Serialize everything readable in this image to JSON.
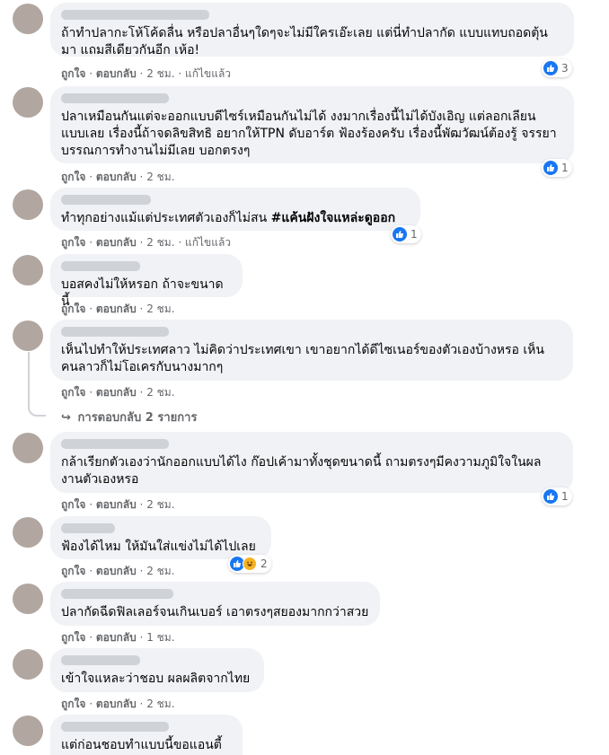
{
  "actions": {
    "like": "ถูกใจ",
    "reply": "ตอบกลับ",
    "edited": "แก้ไขแล้ว",
    "sep": " · "
  },
  "comments": [
    {
      "text": "ถ้าทำปลากะโห้โค้ดลื่น หรือปลาอื่นๆใดๆจะไม่มีใครเอ๊ะเลย แต่นี่ทำปลากัด แบบแทบถอดตุ้น\nมา แถมสีเดียวกันอีก เห้อ!",
      "time": "2 ชม.",
      "edited": true,
      "reactions": "3"
    },
    {
      "text": "ปลาเหมือนกันแต่จะออกแบบดีไซร์เหมือนกันไม่ได้ งงมากเรื่องนี้ไม่ได้บังเอิญ แต่ลอกเลียน\nแบบเลย เรื่องนี้ถ้าจดลิขสิทธิ อยากให้TPN ดับอาร์ต ฟ้องร้องครับ เรื่องนี้พัฒวัฒน์ต้องรู้ จรรยา\nบรรณการทำงานไม่มีเลย บอกตรงๆ",
      "time": "2 ชม.",
      "edited": false,
      "reactions": "1"
    },
    {
      "text_plain": "ทำทุกอย่างแม้แต่ประเทศตัวเองก็ไม่สน ",
      "text_bold": "#แค้นฝังใจแหล่ะดูออก",
      "time": "2 ชม.",
      "edited": true,
      "reactions": "1"
    },
    {
      "text": "บอสคงไม่ให้หรอก ถ้าจะขนาดนี้",
      "time": "2 ชม.",
      "edited": false
    },
    {
      "text": "เห็นไปทำให้ประเทศลาว ไม่คิดว่าประเทศเขา เขาอยากได้ดีไซเนอร์ของตัวเองบ้างหรอ เห็น\nคนลาวก็ไม่โอเครกับนางมากๆ",
      "time": "2 ชม.",
      "edited": false,
      "replies": "การตอบกลับ 2 รายการ"
    },
    {
      "text": "กล้าเรียกตัวเองว่านักออกแบบได้ไง ก๊อปเค้ามาทั้งชุดขนาดนี้ ถามตรงๆมีคงวามภูมิใจในผล\nงานตัวเองหรอ",
      "time": "2 ชม.",
      "edited": false,
      "reactions": "1"
    },
    {
      "text": "ฟ้องได้ไหม ให้มันใส่แข่งไม่ได้ไปเลย",
      "time": "2 ชม.",
      "edited": false,
      "reactions": "2"
    },
    {
      "text": "ปลากัดฉีดฟิลเลอร์จนเกินเบอร์ เอาตรงๆสยองมากกว่าสวย",
      "time": "1 ชม.",
      "edited": false
    },
    {
      "text": "เข้าใจแหละว่าชอบ ผลผลิตจากไทย",
      "time": "2 ชม.",
      "edited": false
    },
    {
      "text": "แต่ก่อนชอบทำแบบนี้ขอแอนตี้"
    }
  ]
}
